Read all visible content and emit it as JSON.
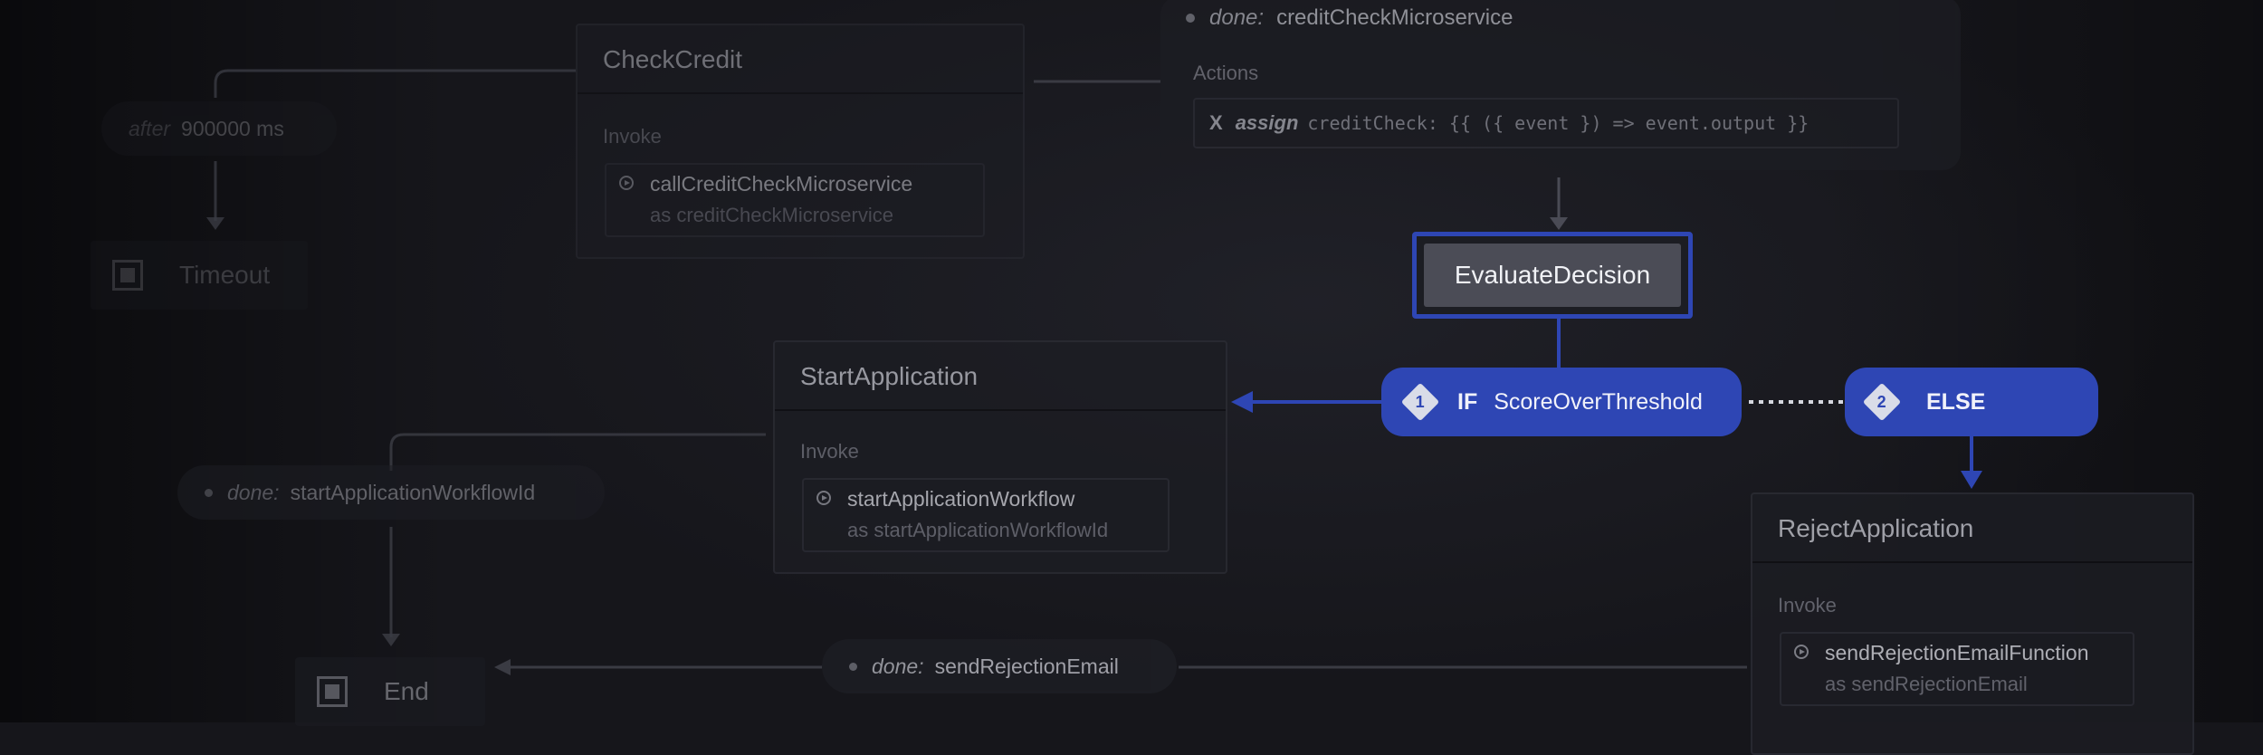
{
  "colors": {
    "background": "#16161b",
    "accent": "#2e46b4",
    "node_bg": "#1c1d23"
  },
  "timeout_transition": {
    "keyword": "after",
    "delay": "900000 ms"
  },
  "timeout_state": {
    "label": "Timeout",
    "icon": "final-state-icon"
  },
  "check_credit": {
    "title": "CheckCredit",
    "section": "Invoke",
    "invoke_src": "callCreditCheckMicroservice",
    "invoke_as": "as creditCheckMicroservice"
  },
  "done_credit": {
    "keyword": "done:",
    "event": "creditCheckMicroservice",
    "actions_label": "Actions",
    "action_marker": "X",
    "action_keyword": "assign",
    "action_code": "creditCheck: {{ ({ event }) => event.output }}"
  },
  "evaluate_decision": {
    "title": "EvaluateDecision"
  },
  "guard_if": {
    "index": "1",
    "keyword": "IF",
    "condition": "ScoreOverThreshold"
  },
  "guard_else": {
    "index": "2",
    "keyword": "ELSE"
  },
  "start_application": {
    "title": "StartApplication",
    "section": "Invoke",
    "invoke_src": "startApplicationWorkflow",
    "invoke_as": "as startApplicationWorkflowId"
  },
  "done_start": {
    "keyword": "done:",
    "event": "startApplicationWorkflowId"
  },
  "end_state": {
    "label": "End",
    "icon": "final-state-icon"
  },
  "done_reject": {
    "keyword": "done:",
    "event": "sendRejectionEmail"
  },
  "reject_application": {
    "title": "RejectApplication",
    "section": "Invoke",
    "invoke_src": "sendRejectionEmailFunction",
    "invoke_as": "as sendRejectionEmail"
  }
}
